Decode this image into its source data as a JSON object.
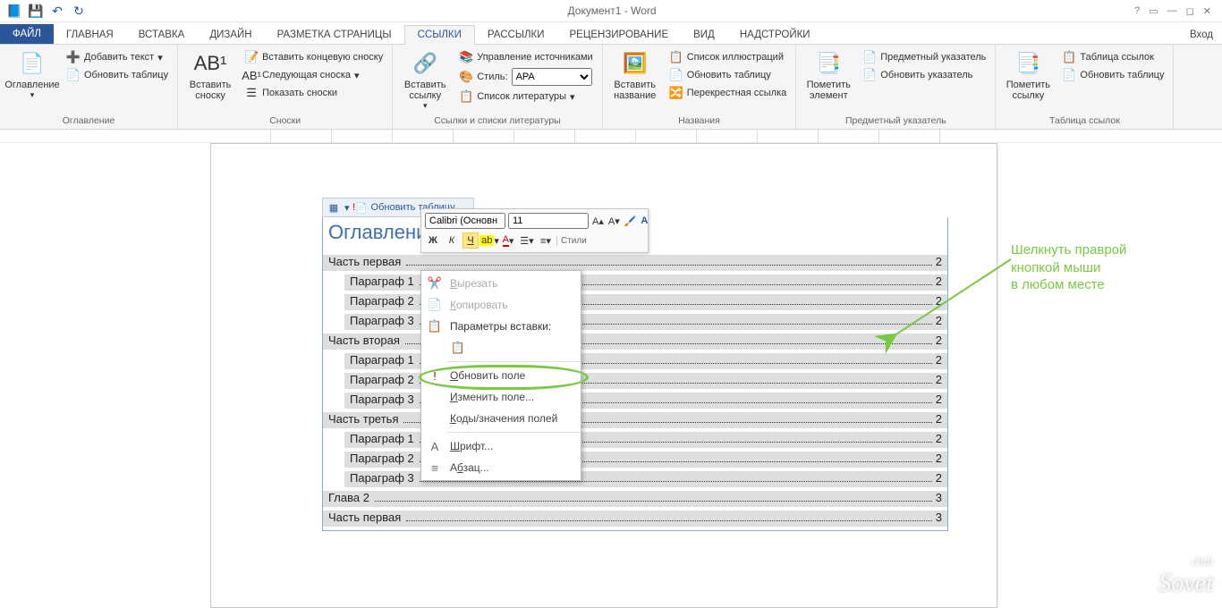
{
  "title_bar": {
    "title": "Документ1 - Word"
  },
  "tabs": {
    "file": "ФАЙЛ",
    "items": [
      "ГЛАВНАЯ",
      "ВСТАВКА",
      "ДИЗАЙН",
      "РАЗМЕТКА СТРАНИЦЫ",
      "ССЫЛКИ",
      "РАССЫЛКИ",
      "РЕЦЕНЗИРОВАНИЕ",
      "ВИД",
      "НАДСТРОЙКИ"
    ],
    "active_index": 4,
    "login": "Вход"
  },
  "ribbon": {
    "toc": {
      "big": "Оглавление",
      "add_text": "Добавить текст",
      "update": "Обновить таблицу",
      "group": "Оглавление"
    },
    "footnotes": {
      "big": "Вставить сноску",
      "endnote": "Вставить концевую сноску",
      "next": "Следующая сноска",
      "show": "Показать сноски",
      "group": "Сноски"
    },
    "citations": {
      "big": "Вставить ссылку",
      "manage": "Управление источниками",
      "style_label": "Стиль:",
      "style_value": "APA",
      "bibliography": "Список литературы",
      "group": "Ссылки и списки литературы"
    },
    "captions": {
      "big": "Вставить название",
      "list": "Список иллюстраций",
      "update": "Обновить таблицу",
      "crossref": "Перекрестная ссылка",
      "group": "Названия"
    },
    "index": {
      "big": "Пометить элемент",
      "subject": "Предметный указатель",
      "update": "Обновить указатель",
      "group": "Предметный указатель"
    },
    "toa": {
      "big": "Пометить ссылку",
      "table": "Таблица ссылок",
      "update": "Обновить таблицу",
      "group": "Таблица ссылок"
    }
  },
  "toc": {
    "toolbar_update": "Обновить таблицу",
    "title": "Оглавление",
    "rows": [
      {
        "label": "Часть первая",
        "page": "2",
        "indent": 0
      },
      {
        "label": "Параграф 1",
        "page": "2",
        "indent": 1
      },
      {
        "label": "Параграф 2",
        "page": "2",
        "indent": 1
      },
      {
        "label": "Параграф 3",
        "page": "2",
        "indent": 1
      },
      {
        "label": "Часть вторая",
        "page": "2",
        "indent": 0
      },
      {
        "label": "Параграф 1",
        "page": "2",
        "indent": 1
      },
      {
        "label": "Параграф 2",
        "page": "2",
        "indent": 1
      },
      {
        "label": "Параграф 3",
        "page": "2",
        "indent": 1
      },
      {
        "label": "Часть третья",
        "page": "2",
        "indent": 0
      },
      {
        "label": "Параграф 1",
        "page": "2",
        "indent": 1
      },
      {
        "label": "Параграф 2",
        "page": "2",
        "indent": 1
      },
      {
        "label": "Параграф 3",
        "page": "2",
        "indent": 1
      },
      {
        "label": "Глава 2",
        "page": "3",
        "indent": 0
      },
      {
        "label": "Часть первая",
        "page": "3",
        "indent": 0
      }
    ]
  },
  "mini_toolbar": {
    "font": "Calibri (Основн",
    "size": "11",
    "bold": "Ж",
    "italic": "К",
    "underline": "Ч",
    "styles": "Стили"
  },
  "context_menu": {
    "cut": "Вырезать",
    "copy": "Копировать",
    "paste_options": "Параметры вставки:",
    "update_field": "Обновить поле",
    "edit_field": "Изменить поле...",
    "toggle_codes": "Коды/значения полей",
    "font": "Шрифт...",
    "paragraph": "Абзац..."
  },
  "annotation": {
    "line1": "Шелкнуть праврой",
    "line2": "кнопкой мыши",
    "line3": "в любом месте"
  },
  "watermark": "Sovet"
}
